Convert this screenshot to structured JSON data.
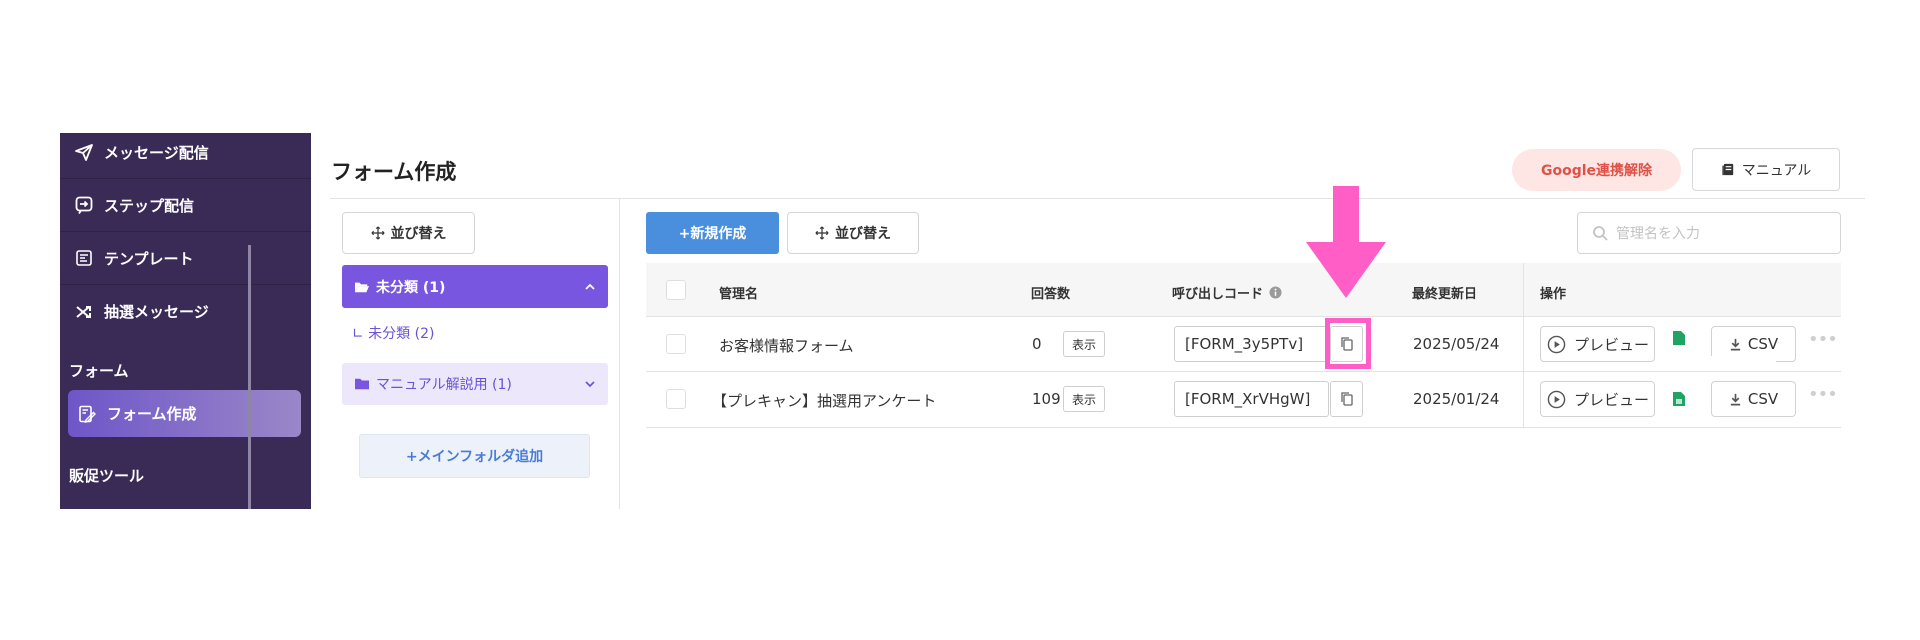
{
  "sidebar": {
    "items": [
      {
        "label": "メッセージ配信",
        "icon": "paper-plane-icon"
      },
      {
        "label": "ステップ配信",
        "icon": "step-message-icon"
      },
      {
        "label": "テンプレート",
        "icon": "template-icon"
      },
      {
        "label": "抽選メッセージ",
        "icon": "shuffle-icon"
      }
    ],
    "section_form": "フォーム",
    "active_item": {
      "label": "フォーム作成",
      "icon": "form-edit-icon"
    },
    "section_promo": "販促ツール"
  },
  "header": {
    "title": "フォーム作成",
    "google_button": "Google連携解除",
    "manual_button": "マニュアル"
  },
  "folders": {
    "sort_button": "並び替え",
    "items": [
      {
        "label": "未分類 (1)",
        "active": true
      },
      {
        "label": "∟ 未分類 (2)"
      },
      {
        "label": "マニュアル解説用 (1)"
      }
    ],
    "add_button": "+メインフォルダ追加"
  },
  "toolbar": {
    "new_button": "+新規作成",
    "sort_button": "並び替え",
    "search_placeholder": "管理名を入力"
  },
  "table": {
    "headers": {
      "name": "管理名",
      "responses": "回答数",
      "code": "呼び出しコード",
      "updated": "最終更新日",
      "actions": "操作"
    },
    "show_label": "表示",
    "preview_label": "プレビュー",
    "csv_label": "CSV",
    "rows": [
      {
        "name": "お客様情報フォーム",
        "responses": "0",
        "code": "[FORM_3y5PTv]",
        "updated": "2025/05/24"
      },
      {
        "name": "【プレキャン】抽選用アンケート",
        "responses": "109",
        "code": "[FORM_XrVHgW]",
        "updated": "2025/01/24"
      }
    ]
  },
  "annotation": {
    "color": "#ff5ec7",
    "shape": "arrow-down",
    "target": "copy-code-button-row-1"
  },
  "colors": {
    "sidebar_bg": "#3a2a56",
    "active_folder": "#7856e0",
    "primary_button": "#4a8ede",
    "google_text": "#e05147"
  }
}
